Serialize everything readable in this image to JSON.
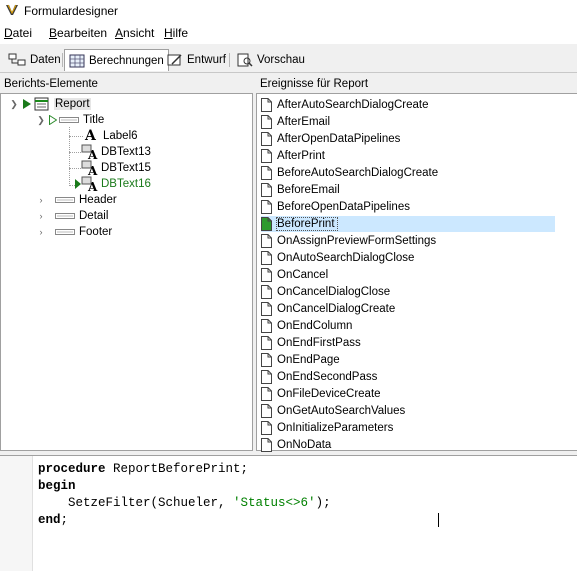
{
  "window": {
    "title": "Formulardesigner"
  },
  "menu": [
    {
      "underline": "D",
      "rest": "atei"
    },
    {
      "underline": "B",
      "rest": "earbeiten"
    },
    {
      "underline": "A",
      "rest": "nsicht"
    },
    {
      "underline": "H",
      "rest": "ilfe"
    }
  ],
  "tabs": [
    {
      "label": "Daten",
      "icon": "data-icon"
    },
    {
      "label": "Berechnungen",
      "icon": "calc-icon",
      "active": true
    },
    {
      "label": "Entwurf",
      "icon": "design-icon"
    },
    {
      "label": "Vorschau",
      "icon": "preview-icon"
    }
  ],
  "left_panel": {
    "header": "Berichts-Elemente",
    "tree": {
      "report": "Report",
      "title": "Title",
      "title_children": [
        "Label6",
        "DBText13",
        "DBText15",
        "DBText16"
      ],
      "bands": [
        "Header",
        "Detail",
        "Footer"
      ]
    }
  },
  "right_panel": {
    "header": "Ereignisse für Report",
    "events": [
      "AfterAutoSearchDialogCreate",
      "AfterEmail",
      "AfterOpenDataPipelines",
      "AfterPrint",
      "BeforeAutoSearchDialogCreate",
      "BeforeEmail",
      "BeforeOpenDataPipelines",
      "BeforePrint",
      "OnAssignPreviewFormSettings",
      "OnAutoSearchDialogClose",
      "OnCancel",
      "OnCancelDialogClose",
      "OnCancelDialogCreate",
      "OnEndColumn",
      "OnEndFirstPass",
      "OnEndPage",
      "OnEndSecondPass",
      "OnFileDeviceCreate",
      "OnGetAutoSearchValues",
      "OnInitializeParameters",
      "OnNoData"
    ],
    "selected_event": "BeforePrint"
  },
  "editor": {
    "line1_kw": "procedure",
    "line1_rest": " ReportBeforePrint;",
    "line2_kw": "begin",
    "line3_pre": "    SetzeFilter(Schueler, ",
    "line3_str": "'Status<>6'",
    "line3_post": ");",
    "line4_kw": "end",
    "line4_rest": ";"
  },
  "colors": {
    "selection": "#cce8ff",
    "string": "#008000",
    "active_node": "#008000"
  }
}
